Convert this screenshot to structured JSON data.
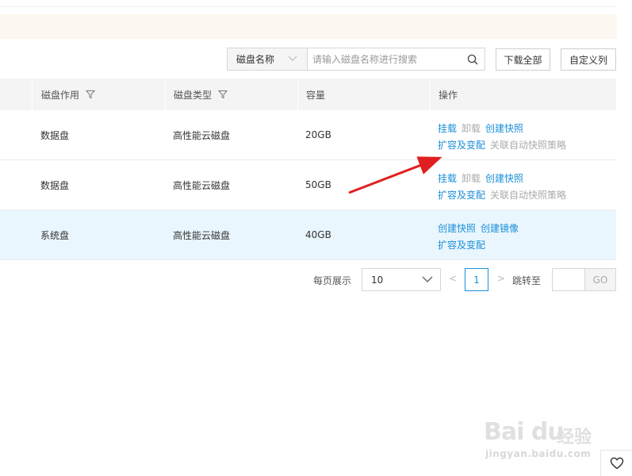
{
  "toolbar": {
    "search_field_select": "磁盘名称",
    "search_placeholder": "请输入磁盘名称进行搜索",
    "download_all": "下载全部",
    "custom_columns": "自定义列"
  },
  "table": {
    "headers": {
      "usage": "磁盘作用",
      "type": "磁盘类型",
      "capacity": "容量",
      "actions": "操作"
    },
    "rows": [
      {
        "usage": "数据盘",
        "type": "高性能云磁盘",
        "capacity": "20GB",
        "actions_line1": [
          {
            "label": "挂载",
            "enabled": true
          },
          {
            "label": "卸载",
            "enabled": false
          },
          {
            "label": "创建快照",
            "enabled": true
          }
        ],
        "actions_line2": [
          {
            "label": "扩容及变配",
            "enabled": true
          },
          {
            "label": "关联自动快照策略",
            "enabled": false
          }
        ]
      },
      {
        "usage": "数据盘",
        "type": "高性能云磁盘",
        "capacity": "50GB",
        "actions_line1": [
          {
            "label": "挂载",
            "enabled": true
          },
          {
            "label": "卸载",
            "enabled": false
          },
          {
            "label": "创建快照",
            "enabled": true
          }
        ],
        "actions_line2": [
          {
            "label": "扩容及变配",
            "enabled": true
          },
          {
            "label": "关联自动快照策略",
            "enabled": false
          }
        ]
      },
      {
        "usage": "系统盘",
        "type": "高性能云磁盘",
        "capacity": "40GB",
        "actions_line1": [
          {
            "label": "创建快照",
            "enabled": true
          },
          {
            "label": "创建镜像",
            "enabled": true
          }
        ],
        "actions_line2": [
          {
            "label": "扩容及变配",
            "enabled": true
          }
        ]
      }
    ]
  },
  "pagination": {
    "page_size_label": "每页展示",
    "page_size": "10",
    "prev": "<",
    "current_page": "1",
    "next": ">",
    "jump_label": "跳转至",
    "go": "GO"
  },
  "watermark": {
    "brand": "Bai du",
    "brand_cn": "经验",
    "url": "jingyan.baidu.com"
  },
  "colors": {
    "link": "#1a8fd8",
    "disabled": "#aaaaaa",
    "highlight_row": "#eaf6fd",
    "arrow": "#e02020"
  }
}
